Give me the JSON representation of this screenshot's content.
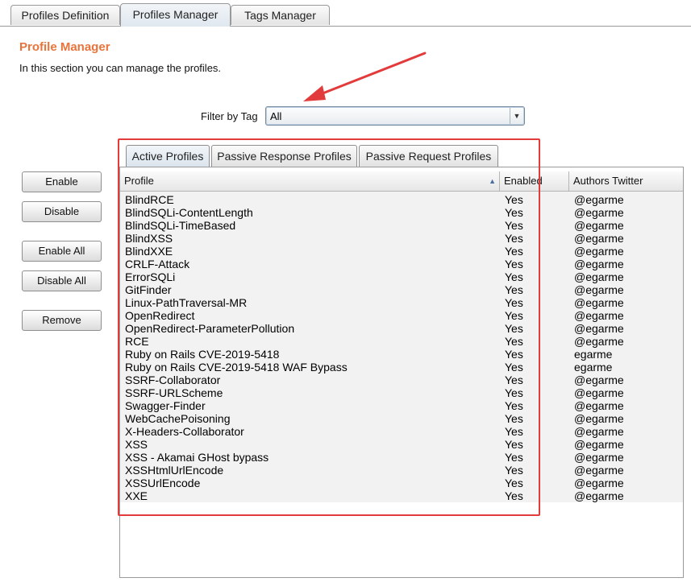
{
  "top_tabs": [
    {
      "label": "Profiles Definition",
      "active": false
    },
    {
      "label": "Profiles Manager",
      "active": true
    },
    {
      "label": "Tags Manager",
      "active": false
    }
  ],
  "section": {
    "title": "Profile Manager",
    "description": "In this section you can manage the profiles."
  },
  "filter": {
    "label": "Filter by Tag",
    "selected": "All"
  },
  "buttons": {
    "enable": "Enable",
    "disable": "Disable",
    "enable_all": "Enable All",
    "disable_all": "Disable All",
    "remove": "Remove"
  },
  "inner_tabs": [
    {
      "label": "Active Profiles",
      "active": true
    },
    {
      "label": "Passive Response Profiles",
      "active": false
    },
    {
      "label": "Passive Request Profiles",
      "active": false
    }
  ],
  "table": {
    "columns": [
      "Profile",
      "Enabled",
      "Authors Twitter"
    ],
    "rows": [
      [
        "BlindRCE",
        "Yes",
        "@egarme"
      ],
      [
        "BlindSQLi-ContentLength",
        "Yes",
        "@egarme"
      ],
      [
        "BlindSQLi-TimeBased",
        "Yes",
        "@egarme"
      ],
      [
        "BlindXSS",
        "Yes",
        "@egarme"
      ],
      [
        "BlindXXE",
        "Yes",
        "@egarme"
      ],
      [
        "CRLF-Attack",
        "Yes",
        "@egarme"
      ],
      [
        "ErrorSQLi",
        "Yes",
        "@egarme"
      ],
      [
        "GitFinder",
        "Yes",
        "@egarme"
      ],
      [
        "Linux-PathTraversal-MR",
        "Yes",
        "@egarme"
      ],
      [
        "OpenRedirect",
        "Yes",
        "@egarme"
      ],
      [
        "OpenRedirect-ParameterPollution",
        "Yes",
        "@egarme"
      ],
      [
        "RCE",
        "Yes",
        "@egarme"
      ],
      [
        "Ruby on Rails CVE-2019-5418",
        "Yes",
        "egarme"
      ],
      [
        "Ruby on Rails CVE-2019-5418 WAF Bypass",
        "Yes",
        "egarme"
      ],
      [
        "SSRF-Collaborator",
        "Yes",
        "@egarme"
      ],
      [
        "SSRF-URLScheme",
        "Yes",
        "@egarme"
      ],
      [
        "Swagger-Finder",
        "Yes",
        "@egarme"
      ],
      [
        "WebCachePoisoning",
        "Yes",
        "@egarme"
      ],
      [
        "X-Headers-Collaborator",
        "Yes",
        "@egarme"
      ],
      [
        "XSS",
        "Yes",
        "@egarme"
      ],
      [
        "XSS - Akamai GHost bypass",
        "Yes",
        "@egarme"
      ],
      [
        "XSSHtmlUrlEncode",
        "Yes",
        "@egarme"
      ],
      [
        "XSSUrlEncode",
        "Yes",
        "@egarme"
      ],
      [
        "XXE",
        "Yes",
        "@egarme"
      ]
    ]
  },
  "colors": {
    "title": "#e8743b",
    "annotation": "#e23b3b"
  },
  "icons": {
    "sort": "sort-ascending-icon",
    "dropdown": "chevron-down-icon"
  }
}
